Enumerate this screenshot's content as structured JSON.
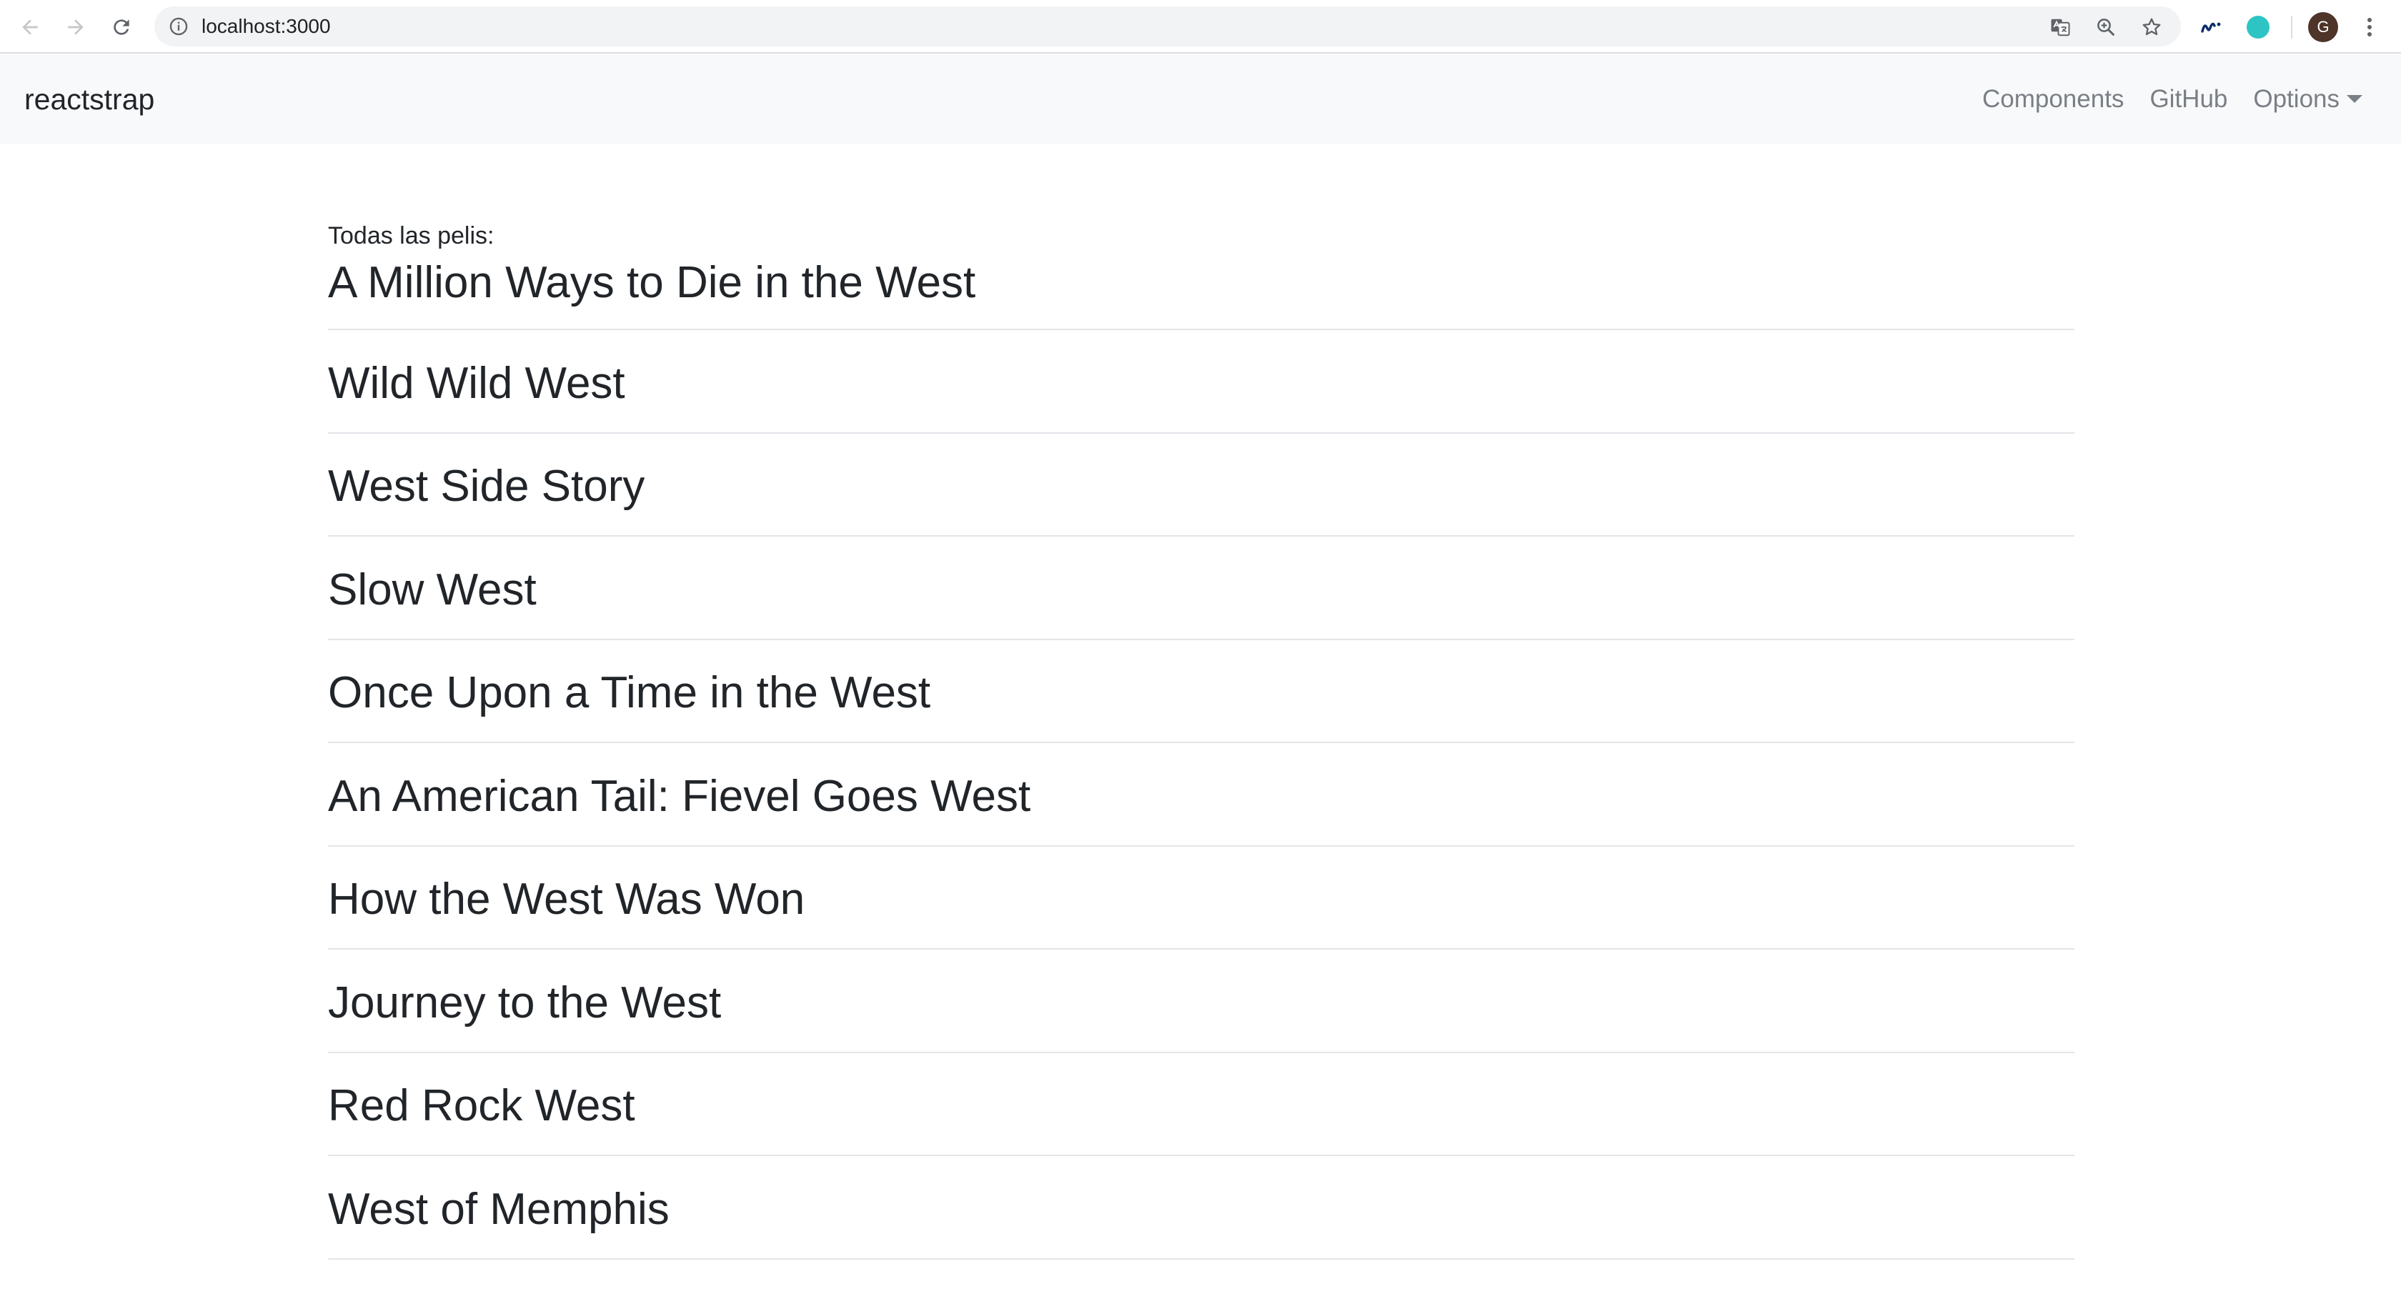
{
  "browser": {
    "url": "localhost:3000",
    "avatar_letter": "G",
    "icons": [
      "back-icon",
      "forward-icon",
      "reload-icon",
      "info-icon",
      "translate-icon",
      "zoom-icon",
      "star-icon",
      "movistar-extension-icon",
      "teal-extension-icon",
      "more-menu-icon"
    ]
  },
  "navbar": {
    "brand": "reactstrap",
    "links": [
      "Components",
      "GitHub",
      "Options"
    ]
  },
  "main": {
    "label": "Todas las pelis:",
    "movies": [
      "A Million Ways to Die in the West",
      "Wild Wild West",
      "West Side Story",
      "Slow West",
      "Once Upon a Time in the West",
      "An American Tail: Fievel Goes West",
      "How the West Was Won",
      "Journey to the West",
      "Red Rock West",
      "West of Memphis"
    ]
  },
  "colors": {
    "navbar_bg": "#f8f9fa",
    "text": "#212529",
    "nav_link": "#7a7f85",
    "divider": "#e3e5e8",
    "teal_extension": "#2ec4c4"
  }
}
